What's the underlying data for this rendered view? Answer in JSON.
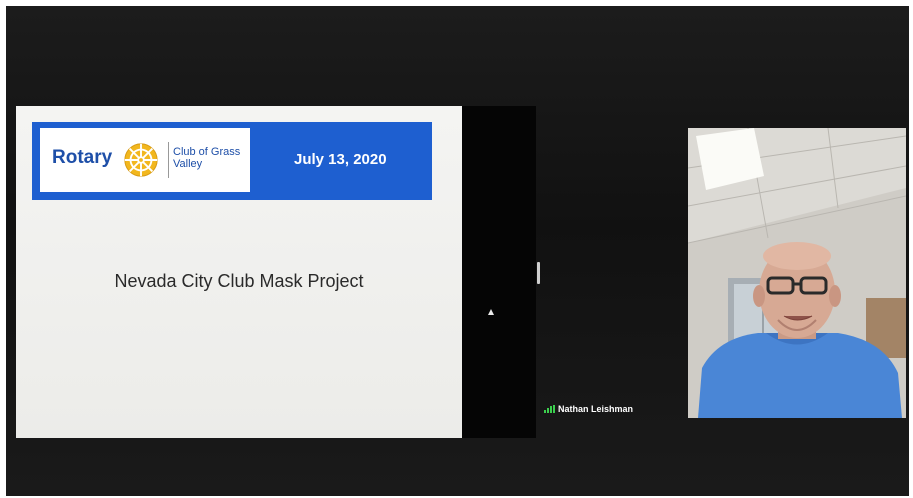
{
  "meeting": {
    "shared_slide": {
      "logo_word": "Rotary",
      "logo_sub": "Club of Grass Valley",
      "date": "July 13, 2020",
      "title": "Nevada City Club Mask Project"
    },
    "participant": {
      "name": "Nathan Leishman",
      "signal_icon": "signal-bars-icon"
    },
    "colors": {
      "banner": "#1e5fd0",
      "logo_text": "#1e4fa8",
      "background": "#141414",
      "signal": "#3ccf4e",
      "shirt": "#4a86d6"
    }
  }
}
